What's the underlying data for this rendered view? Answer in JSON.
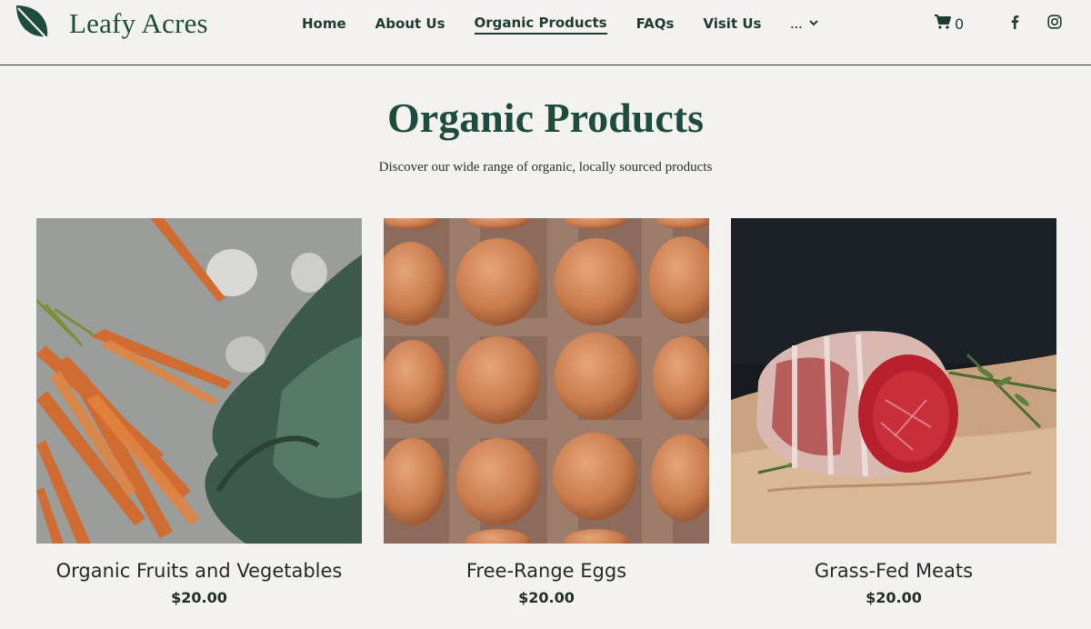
{
  "brand": {
    "name": "Leafy Acres",
    "logo_icon": "leaf-icon",
    "color": "#1d4b3e"
  },
  "nav": {
    "items": [
      {
        "label": "Home",
        "active": false
      },
      {
        "label": "About Us",
        "active": false
      },
      {
        "label": "Organic Products",
        "active": true
      },
      {
        "label": "FAQs",
        "active": false
      },
      {
        "label": "Visit Us",
        "active": false
      }
    ],
    "more_label": "...",
    "more_icon": "chevron-down-icon"
  },
  "cart": {
    "icon": "cart-icon",
    "count": "0"
  },
  "social": {
    "facebook_icon": "facebook-icon",
    "instagram_icon": "instagram-icon"
  },
  "hero": {
    "title": "Organic Products",
    "subtitle": "Discover our wide range of organic, locally sourced products"
  },
  "products": [
    {
      "name": "Organic Fruits and Vegetables",
      "price": "$20.00",
      "image": "carrots-and-kale-photo"
    },
    {
      "name": "Free-Range Eggs",
      "price": "$20.00",
      "image": "eggs-in-carton-photo"
    },
    {
      "name": "Grass-Fed Meats",
      "price": "$20.00",
      "image": "raw-beef-roast-photo"
    }
  ],
  "colors": {
    "background": "#f4f2ef",
    "accent": "#1d4b3e",
    "text": "#1f3a36"
  }
}
